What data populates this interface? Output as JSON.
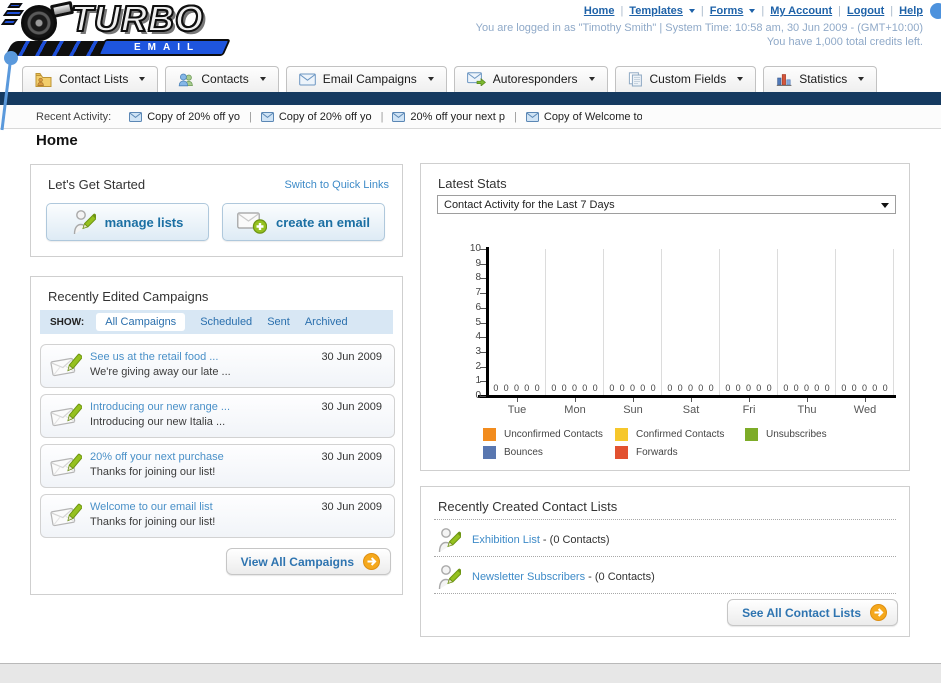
{
  "header": {
    "logo": {
      "title": "TURBO",
      "subtitle": "EMAIL"
    },
    "nav_links": [
      {
        "label": "Home",
        "dropdown": false
      },
      {
        "label": "Templates",
        "dropdown": true
      },
      {
        "label": "Forms",
        "dropdown": true
      },
      {
        "label": "My Account",
        "dropdown": false
      },
      {
        "label": "Logout",
        "dropdown": false
      },
      {
        "label": "Help",
        "dropdown": false
      }
    ],
    "login_status": "You are logged in as \"Timothy Smith\" | System Time: 10:58 am, 30 Jun 2009 - (GMT+10:00)",
    "credits_note": "You have 1,000 total credits left."
  },
  "main_nav": {
    "tabs": [
      {
        "label": "Contact Lists",
        "icon": "folder-user-icon"
      },
      {
        "label": "Contacts",
        "icon": "users-icon"
      },
      {
        "label": "Email Campaigns",
        "icon": "envelope-icon"
      },
      {
        "label": "Autoresponders",
        "icon": "envelope-forward-icon"
      },
      {
        "label": "Custom Fields",
        "icon": "pages-icon"
      },
      {
        "label": "Statistics",
        "icon": "bar-chart-icon"
      }
    ]
  },
  "recent_activity": {
    "label": "Recent Activity:",
    "items": [
      "Copy of 20% off yo",
      "Copy of 20% off yo",
      "20% off your next p",
      "Copy of Welcome to"
    ]
  },
  "page_title": "Home",
  "get_started": {
    "title": "Let's Get Started",
    "switch_link": "Switch to Quick Links",
    "buttons": [
      {
        "label": "manage lists",
        "icon": "user-pencil-icon"
      },
      {
        "label": "create an email",
        "icon": "envelope-plus-icon"
      }
    ]
  },
  "campaigns": {
    "title": "Recently Edited Campaigns",
    "show_label": "SHOW:",
    "filters": [
      {
        "label": "All Campaigns",
        "active": true
      },
      {
        "label": "Scheduled",
        "active": false
      },
      {
        "label": "Sent",
        "active": false
      },
      {
        "label": "Archived",
        "active": false
      }
    ],
    "items": [
      {
        "title": "See us at the retail food ...",
        "subtitle": "We're giving away our late ...",
        "date": "30 Jun 2009"
      },
      {
        "title": "Introducing our new range ...",
        "subtitle": "Introducing our new Italia ...",
        "date": "30 Jun 2009"
      },
      {
        "title": "20% off your next purchase",
        "subtitle": "Thanks for joining our list!",
        "date": "30 Jun 2009"
      },
      {
        "title": "Welcome to our email list",
        "subtitle": "Thanks for joining our list!",
        "date": "30 Jun 2009"
      }
    ],
    "view_all_label": "View All Campaigns"
  },
  "latest_stats": {
    "title": "Latest Stats",
    "dropdown_value": "Contact Activity for the Last 7 Days"
  },
  "contact_lists": {
    "title": "Recently Created Contact Lists",
    "items": [
      {
        "name": "Exhibition List",
        "detail": "- (0 Contacts)"
      },
      {
        "name": "Newsletter Subscribers",
        "detail": "- (0 Contacts)"
      }
    ],
    "see_all_label": "See All Contact Lists"
  },
  "chart_data": {
    "type": "bar",
    "title": "Contact Activity for the Last 7 Days",
    "categories": [
      "Tue",
      "Mon",
      "Sun",
      "Sat",
      "Fri",
      "Thu",
      "Wed"
    ],
    "series": [
      {
        "name": "Unconfirmed Contacts",
        "color": "#F28C1E",
        "values": [
          0,
          0,
          0,
          0,
          0,
          0,
          0
        ]
      },
      {
        "name": "Confirmed Contacts",
        "color": "#F6C72B",
        "values": [
          0,
          0,
          0,
          0,
          0,
          0,
          0
        ]
      },
      {
        "name": "Unsubscribes",
        "color": "#7DAC28",
        "values": [
          0,
          0,
          0,
          0,
          0,
          0,
          0
        ]
      },
      {
        "name": "Bounces",
        "color": "#5977B0",
        "values": [
          0,
          0,
          0,
          0,
          0,
          0,
          0
        ]
      },
      {
        "name": "Forwards",
        "color": "#E25130",
        "values": [
          0,
          0,
          0,
          0,
          0,
          0,
          0
        ]
      }
    ],
    "xlabel": "",
    "ylabel": "",
    "ylim": [
      0,
      10
    ],
    "yticks": [
      0,
      1,
      2,
      3,
      4,
      5,
      6,
      7,
      8,
      9,
      10
    ],
    "grid": true,
    "legend_position": "bottom",
    "value_labels_shown": true
  },
  "colors": {
    "navy_bar": "#153A60",
    "link_blue": "#1E62A8",
    "panel_link_blue": "#3E8BC8",
    "accent_orange": "#F5A81C",
    "pencil_green": "#95C11F"
  }
}
